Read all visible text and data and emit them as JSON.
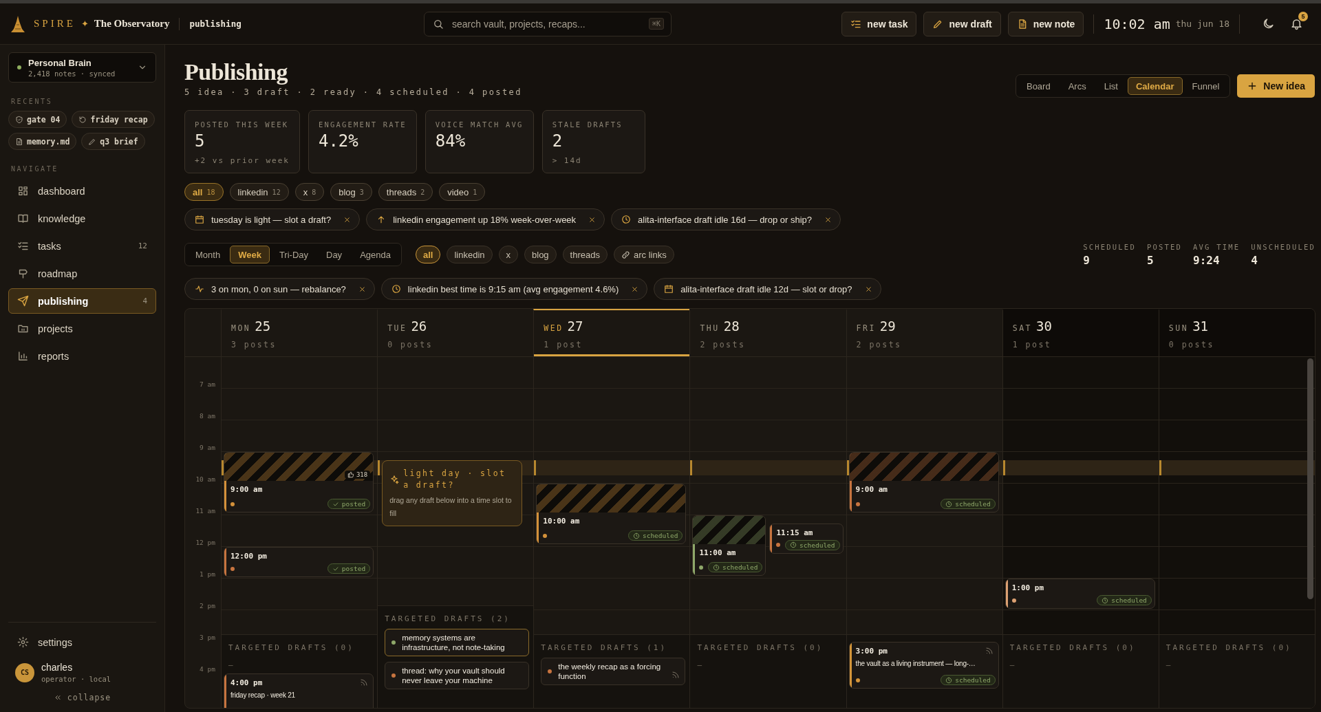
{
  "brand": {
    "name": "SPIRE",
    "separator": "✦",
    "product": "The Observatory",
    "section": "publishing"
  },
  "search": {
    "placeholder": "search vault, projects, recaps...",
    "shortcut": "⌘K"
  },
  "header_actions": [
    {
      "label": "new task",
      "kind": "task"
    },
    {
      "label": "new draft",
      "kind": "draft"
    },
    {
      "label": "new note",
      "kind": "note"
    }
  ],
  "clock": {
    "time": "10:02 am",
    "date": "thu jun 18"
  },
  "notifications": {
    "count": "5"
  },
  "workspace": {
    "name": "Personal Brain",
    "meta": "2,418 notes · synced"
  },
  "recents": {
    "label": "RECENTS",
    "items": [
      {
        "label": "gate 04",
        "kind": "gate"
      },
      {
        "label": "friday recap",
        "kind": "recap"
      },
      {
        "label": "memory.md",
        "kind": "file"
      },
      {
        "label": "q3 brief",
        "kind": "edit"
      }
    ]
  },
  "navigate": {
    "label": "NAVIGATE",
    "items": [
      {
        "label": "dashboard",
        "kind": "dashboard",
        "selected": false
      },
      {
        "label": "knowledge",
        "kind": "knowledge",
        "selected": false
      },
      {
        "label": "tasks",
        "kind": "tasks",
        "count": "12",
        "selected": false
      },
      {
        "label": "roadmap",
        "kind": "roadmap",
        "selected": false
      },
      {
        "label": "publishing",
        "kind": "publishing",
        "count": "4",
        "selected": true
      },
      {
        "label": "projects",
        "kind": "projects",
        "selected": false
      },
      {
        "label": "reports",
        "kind": "reports",
        "selected": false
      }
    ]
  },
  "footer": {
    "settings": "settings",
    "user": {
      "initials": "CS",
      "name": "charles",
      "role": "operator · local"
    },
    "collapse": "collapse"
  },
  "page": {
    "title": "Publishing",
    "summary": "5 idea · 3 draft · 2 ready · 4 scheduled · 4 posted"
  },
  "views": [
    {
      "label": "Board",
      "selected": false
    },
    {
      "label": "Arcs",
      "selected": false
    },
    {
      "label": "List",
      "selected": false
    },
    {
      "label": "Calendar",
      "selected": true
    },
    {
      "label": "Funnel",
      "selected": false
    }
  ],
  "new_idea": "New idea",
  "stats": [
    {
      "label": "POSTED THIS WEEK",
      "value": "5",
      "note": "+2 vs prior week"
    },
    {
      "label": "ENGAGEMENT RATE",
      "value": "4.2%"
    },
    {
      "label": "VOICE MATCH AVG",
      "value": "84%"
    },
    {
      "label": "STALE DRAFTS",
      "value": "2",
      "note": "> 14d"
    }
  ],
  "platform_filters": [
    {
      "label": "all",
      "count": "18",
      "selected": true
    },
    {
      "label": "linkedin",
      "count": "12",
      "selected": false
    },
    {
      "label": "x",
      "count": "8",
      "selected": false
    },
    {
      "label": "blog",
      "count": "3",
      "selected": false
    },
    {
      "label": "threads",
      "count": "2",
      "selected": false
    },
    {
      "label": "video",
      "count": "1",
      "selected": false
    }
  ],
  "insights": [
    {
      "text": "tuesday is light — slot a draft?",
      "kind": "calendar"
    },
    {
      "text": "linkedin engagement up 18% week-over-week",
      "kind": "trend"
    },
    {
      "text": "alita-interface draft idle 16d — drop or ship?",
      "kind": "clock"
    }
  ],
  "calendar": {
    "ranges": [
      {
        "label": "Month",
        "selected": false
      },
      {
        "label": "Week",
        "selected": true
      },
      {
        "label": "Tri-Day",
        "selected": false
      },
      {
        "label": "Day",
        "selected": false
      },
      {
        "label": "Agenda",
        "selected": false
      }
    ],
    "channels": [
      {
        "label": "all",
        "selected": true
      },
      {
        "label": "linkedin",
        "selected": false
      },
      {
        "label": "x",
        "selected": false
      },
      {
        "label": "blog",
        "selected": false
      },
      {
        "label": "threads",
        "selected": false
      }
    ],
    "arc_links": "arc links",
    "summary": [
      {
        "label": "SCHEDULED",
        "value": "9"
      },
      {
        "label": "POSTED",
        "value": "5"
      },
      {
        "label": "AVG TIME",
        "value": "9:24"
      },
      {
        "label": "UNSCHEDULED",
        "value": "4"
      }
    ],
    "insights": [
      {
        "text": "3 on mon, 0 on sun — rebalance?",
        "kind": "pulse"
      },
      {
        "text": "linkedin best time is 9:15 am (avg engagement 4.6%)",
        "kind": "clock"
      },
      {
        "text": "alita-interface draft idle 12d — slot or drop?",
        "kind": "calendar"
      }
    ],
    "best_time_band": true,
    "hours": [
      "7 am",
      "8 am",
      "9 am",
      "10 am",
      "11 am",
      "12 pm",
      "1 pm",
      "2 pm",
      "3 pm",
      "4 pm"
    ],
    "days": [
      {
        "weekday": "MON",
        "date": "25",
        "posts": "3 posts",
        "today": false,
        "weekend": false,
        "events": [
          {
            "time": "9:00 am",
            "color": "#d4913a",
            "preview": true,
            "likes": "318",
            "status": {
              "label": "posted",
              "kind": "posted"
            }
          },
          {
            "time": "12:00 pm",
            "color": "#c7743f",
            "status": {
              "label": "posted",
              "kind": "posted"
            }
          },
          {
            "time": "4:00 pm",
            "title": "friday recap · week 21",
            "color": "#c7743f",
            "feed": true
          }
        ],
        "targeted": {
          "label": "TARGETED DRAFTS (0)",
          "empty": "—"
        }
      },
      {
        "weekday": "TUE",
        "date": "26",
        "posts": "0 posts",
        "today": false,
        "weekend": false,
        "suggestion": {
          "title": "light day · slot a draft?",
          "body": "drag any draft below into a time slot to fill"
        },
        "targeted": {
          "label": "TARGETED DRAFTS (2)",
          "items": [
            {
              "text": "memory systems are infrastructure, not note-taking",
              "color": "#8fa86a",
              "selected": true,
              "feed": false
            },
            {
              "text": "thread: why your vault should never leave your machine",
              "color": "#c7743f",
              "selected": false,
              "feed": false
            }
          ]
        }
      },
      {
        "weekday": "WED",
        "date": "27",
        "posts": "1 post",
        "today": true,
        "weekend": false,
        "events": [
          {
            "time": "10:00 am",
            "color": "#d4913a",
            "preview": true,
            "status": {
              "label": "scheduled",
              "kind": "scheduled"
            }
          }
        ],
        "targeted": {
          "label": "TARGETED DRAFTS (1)",
          "items": [
            {
              "text": "the weekly recap as a forcing function",
              "color": "#c7743f",
              "selected": false,
              "feed": true
            }
          ]
        }
      },
      {
        "weekday": "THU",
        "date": "28",
        "posts": "2 posts",
        "today": false,
        "weekend": false,
        "events": [
          {
            "time": "11:00 am",
            "color": "#8fa86a",
            "preview": true,
            "status": {
              "label": "scheduled",
              "kind": "scheduled"
            }
          },
          {
            "time": "11:15 am",
            "color": "#c7743f",
            "status": {
              "label": "scheduled",
              "kind": "scheduled"
            }
          }
        ],
        "targeted": {
          "label": "TARGETED DRAFTS (0)",
          "empty": "—"
        }
      },
      {
        "weekday": "FRI",
        "date": "29",
        "posts": "2 posts",
        "today": false,
        "weekend": false,
        "events": [
          {
            "time": "9:00 am",
            "color": "#c7743f",
            "preview": true,
            "status": {
              "label": "scheduled",
              "kind": "scheduled"
            }
          },
          {
            "time": "3:00 pm",
            "title": "the vault as a living instrument — long-…",
            "color": "#d4953a",
            "feed": true,
            "status": {
              "label": "scheduled",
              "kind": "scheduled"
            }
          }
        ]
      },
      {
        "weekday": "SAT",
        "date": "30",
        "posts": "1 post",
        "today": false,
        "weekend": true,
        "events": [
          {
            "time": "1:00 pm",
            "color": "#dca072",
            "status": {
              "label": "scheduled",
              "kind": "scheduled"
            }
          }
        ],
        "targeted": {
          "label": "TARGETED DRAFTS (0)",
          "empty": "—"
        }
      },
      {
        "weekday": "SUN",
        "date": "31",
        "posts": "0 posts",
        "today": false,
        "weekend": true,
        "targeted": {
          "label": "TARGETED DRAFTS (0)",
          "empty": "—"
        }
      }
    ]
  }
}
